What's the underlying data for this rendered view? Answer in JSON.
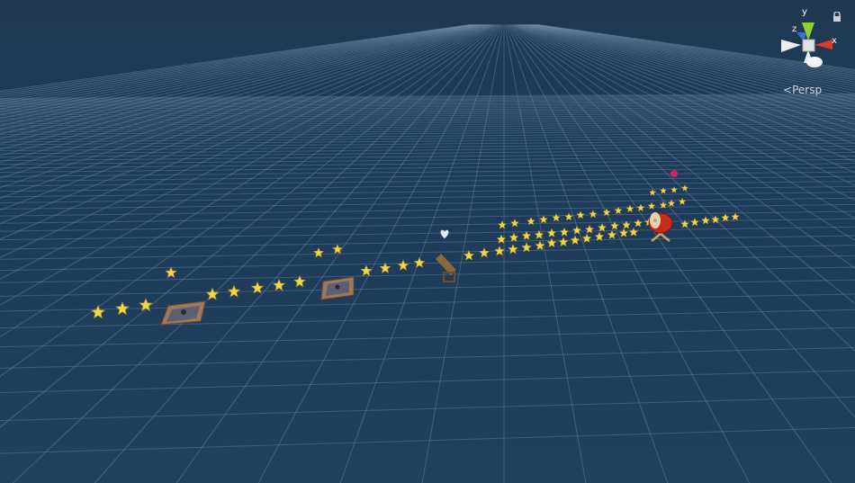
{
  "scene_view": {
    "projection_label": "Persp",
    "gizmo": {
      "y_label": "y",
      "x_label": "x",
      "z_label": "z",
      "y_color": "#8fd12b",
      "x_color": "#e0382a",
      "z_color": "#3d6fd6"
    },
    "background_color": "#21405e",
    "grid_color": "#6f8ba7"
  },
  "scene_objects": [
    {
      "name": "collectible-stars",
      "icon": "star",
      "color": "#f2d64a"
    },
    {
      "name": "trampoline-pad-1",
      "icon": "trampoline"
    },
    {
      "name": "trampoline-pad-2",
      "icon": "trampoline"
    },
    {
      "name": "heart-pickup",
      "icon": "heart"
    },
    {
      "name": "wooden-cannon",
      "icon": "cannon"
    },
    {
      "name": "taiko-drum",
      "icon": "drum",
      "color": "#c8271d"
    },
    {
      "name": "magenta-marker",
      "icon": "dot",
      "color": "#d0246a"
    }
  ]
}
